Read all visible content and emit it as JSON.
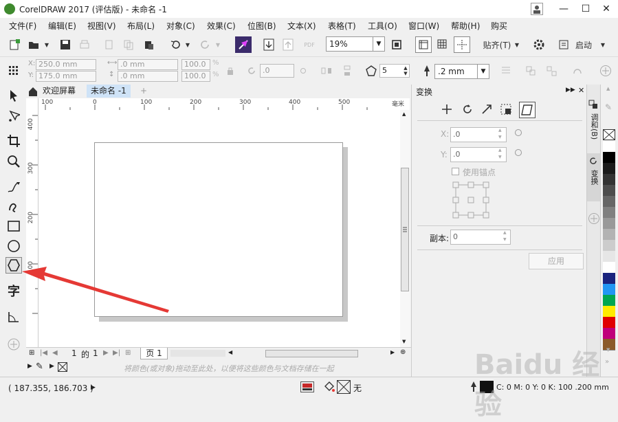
{
  "window": {
    "title": "CorelDRAW 2017 (评估版) - 未命名 -1",
    "minimize": "—",
    "maximize": "☐",
    "close": "✕"
  },
  "menu": [
    "文件(F)",
    "编辑(E)",
    "视图(V)",
    "布局(L)",
    "对象(C)",
    "效果(C)",
    "位图(B)",
    "文本(X)",
    "表格(T)",
    "工具(O)",
    "窗口(W)",
    "帮助(H)",
    "购买"
  ],
  "toolbar": {
    "zoom": "19%",
    "snap_label": "贴齐(T)",
    "launch_label": "启动",
    "pdf_label": "PDF"
  },
  "property_bar": {
    "x": "250.0 mm",
    "y": "175.0 mm",
    "w": ".0 mm",
    "h": ".0 mm",
    "scale_w": "100.0",
    "scale_h": "100.0",
    "percent": "%",
    "rotation": ".0",
    "sides": "5",
    "outline": ".2 mm"
  },
  "tabs": {
    "welcome": "欢迎屏幕",
    "document": "未命名 -1",
    "add": "+"
  },
  "ruler": {
    "h_ticks": [
      "100",
      "0",
      "100",
      "200",
      "300",
      "400",
      "500"
    ],
    "unit": "毫米",
    "v_ticks": [
      "400",
      "300",
      "200",
      "100"
    ]
  },
  "page_nav": {
    "current": "1",
    "of": "的",
    "total": "1",
    "page_tab": "页 1"
  },
  "color_hint": "将颜色(或对象)拖动至此处，以便将这些颜色与文档存储在一起",
  "status": {
    "coords": "( 187.355, 186.703 )",
    "fill_none": "无",
    "color_info": "C: 0 M: 0 Y: 0 K: 100 .200 mm"
  },
  "docker": {
    "title": "变换",
    "x_label": "X:",
    "x_value": ".0",
    "y_label": "Y:",
    "y_value": ".0",
    "anchor_label": "使用锚点",
    "copies_label": "副本:",
    "copies_value": "0",
    "apply_label": "应用"
  },
  "docker_tabs": [
    "调和(B)",
    "变换"
  ],
  "palette": [
    "#ffffff",
    "#000000",
    "#1a1a1a",
    "#333333",
    "#4d4d4d",
    "#666666",
    "#808080",
    "#999999",
    "#b3b3b3",
    "#cccccc",
    "#e6e6e6",
    "#ffffff",
    "#1a237e",
    "#2196f3",
    "#00a651",
    "#ffeb00",
    "#e00000",
    "#c0007a",
    "#8b5a2b"
  ],
  "watermark": "Baidu 经验",
  "colors": {
    "arrow": "#e53935",
    "tab_active": "#cfe3f7"
  }
}
